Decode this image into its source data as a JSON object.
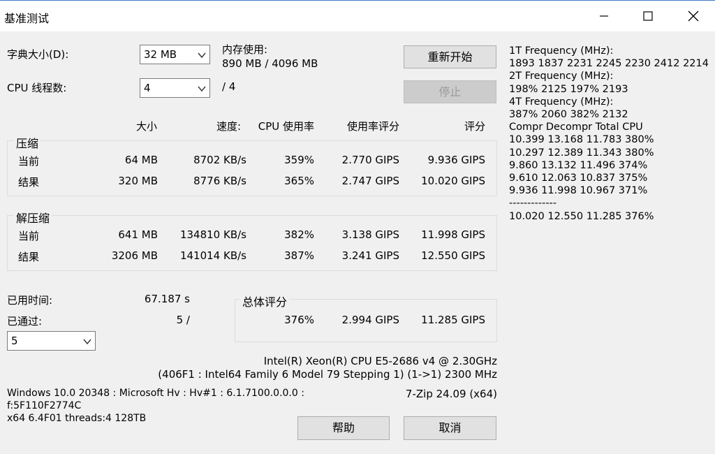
{
  "window": {
    "title": "基准测试"
  },
  "controls": {
    "dict_label": "字典大小(D):",
    "dict_value": "32 MB",
    "threads_label": "CPU 线程数:",
    "threads_value": "4",
    "threads_max": "/ 4",
    "mem_label": "内存使用:",
    "mem_value": "890 MB / 4096 MB",
    "restart_label": "重新开始",
    "stop_label": "停止"
  },
  "headers": {
    "size": "大小",
    "speed": "速度:",
    "cpu": "CPU 使用率",
    "rating_usage": "使用率评分",
    "rating": "评分"
  },
  "compress": {
    "title": "压缩",
    "rows": [
      {
        "label": "当前",
        "size": "64 MB",
        "speed": "8702 KB/s",
        "cpu": "359%",
        "rating_usage": "2.770 GIPS",
        "rating": "9.936 GIPS"
      },
      {
        "label": "结果",
        "size": "320 MB",
        "speed": "8776 KB/s",
        "cpu": "365%",
        "rating_usage": "2.747 GIPS",
        "rating": "10.020 GIPS"
      }
    ]
  },
  "decompress": {
    "title": "解压缩",
    "rows": [
      {
        "label": "当前",
        "size": "641 MB",
        "speed": "134810 KB/s",
        "cpu": "382%",
        "rating_usage": "3.138 GIPS",
        "rating": "11.998 GIPS"
      },
      {
        "label": "结果",
        "size": "3206 MB",
        "speed": "141014 KB/s",
        "cpu": "387%",
        "rating_usage": "3.241 GIPS",
        "rating": "12.550 GIPS"
      }
    ]
  },
  "elapsed": {
    "label": "已用时间:",
    "value": "67.187 s"
  },
  "passes": {
    "label": "已通过:",
    "value": "5 /",
    "select_value": "5"
  },
  "total": {
    "title": "总体评分",
    "cpu": "376%",
    "rating_usage": "2.994 GIPS",
    "rating": "11.285 GIPS"
  },
  "cpu_info": {
    "line1": "Intel(R) Xeon(R) CPU E5-2686 v4 @ 2.30GHz",
    "line2": "(406F1 : Intel64 Family 6 Model 79 Stepping 1) (1->1) 2300 MHz"
  },
  "sys_info": {
    "line1": "Windows 10.0 20348 : Microsoft Hv : Hv#1 : 6.1.7100.0.0.0 :",
    "line2": "f:5F110F2774C",
    "line3": "x64 6.4F01 threads:4 128TB"
  },
  "version": "7-Zip 24.09 (x64)",
  "buttons": {
    "help": "帮助",
    "cancel": "取消"
  },
  "right_panel": {
    "lines": [
      "1T Frequency (MHz):",
      " 1893 1837 2231 2245 2230 2412 2214",
      "2T Frequency (MHz):",
      " 198% 2125 197% 2193",
      "4T Frequency (MHz):",
      " 387% 2060 382% 2132",
      "Compr Decompr Total   CPU",
      "10.399  13.168  11.783   380%",
      "10.297  12.389  11.343   380%",
      "9.860  13.132  11.496   374%",
      "9.610  12.063  10.837   375%",
      "9.936  11.998  10.967   371%",
      "-------------",
      "10.020  12.550  11.285   376%"
    ]
  }
}
